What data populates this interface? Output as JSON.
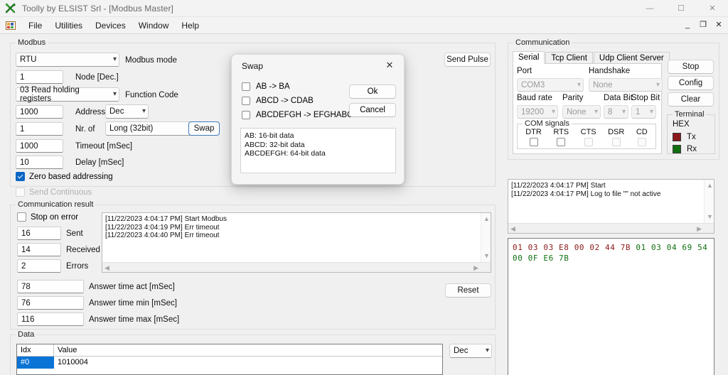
{
  "window": {
    "title": "Toolly by ELSIST Srl - [Modbus Master]",
    "app_icon": "tools-cross-icon",
    "minimize": "—",
    "maximize": "☐",
    "close": "✕"
  },
  "menubar": {
    "icon": "mdi-window-icon",
    "items": [
      "File",
      "Utilities",
      "Devices",
      "Window",
      "Help"
    ],
    "mdi_restore_down": "_",
    "mdi_restore": "❐",
    "mdi_close": "✕"
  },
  "modbus": {
    "legend": "Modbus",
    "mode_value": "RTU",
    "mode_label": "Modbus mode",
    "node_value": "1",
    "node_label": "Node [Dec.]",
    "function_code_value": "03 Read holding registers",
    "function_code_label": "Function Code",
    "address_value": "1000",
    "address_label": "Address",
    "address_base_value": "Dec",
    "nr_of_value": "1",
    "nr_of_label": "Nr. of",
    "data_type_value": "Long (32bit)",
    "swap_button": "Swap",
    "timeout_value": "1000",
    "timeout_label": "Timeout [mSec]",
    "delay_value": "10",
    "delay_label": "Delay [mSec]",
    "zero_based_label": "Zero based addressing",
    "zero_based_checked": true,
    "send_continuous_label": "Send Continuous",
    "send_continuous_checked": false,
    "send_pulse_button": "Send Pulse"
  },
  "comm_result": {
    "legend": "Communication result",
    "stop_on_error_label": "Stop on error",
    "stop_on_error_checked": false,
    "sent_value": "16",
    "sent_label": "Sent",
    "received_value": "14",
    "received_label": "Received",
    "errors_value": "2",
    "errors_label": "Errors",
    "answer_act_value": "78",
    "answer_act_label": "Answer time act [mSec]",
    "answer_min_value": "76",
    "answer_min_label": "Answer time min [mSec]",
    "answer_max_value": "116",
    "answer_max_label": "Answer time max [mSec]",
    "reset_button": "Reset",
    "log_lines": [
      "[11/22/2023 4:04:17 PM] Start Modbus",
      "[11/22/2023 4:04:19 PM] Err timeout",
      "[11/22/2023 4:04:40 PM] Err timeout"
    ]
  },
  "data_panel": {
    "legend": "Data",
    "col_idx": "Idx",
    "col_value": "Value",
    "format_value": "Dec",
    "rows": [
      {
        "idx": "#0",
        "value": "1010004"
      }
    ]
  },
  "communication": {
    "legend": "Communication",
    "tabs": [
      {
        "label": "Serial",
        "active": true
      },
      {
        "label": "Tcp Client",
        "active": false
      },
      {
        "label": "Udp Client Server",
        "active": false
      }
    ],
    "port_label": "Port",
    "port_value": "COM3",
    "handshake_label": "Handshake",
    "handshake_value": "None",
    "baud_label": "Baud rate",
    "baud_value": "19200",
    "parity_label": "Parity",
    "parity_value": "None",
    "data_bit_label": "Data Bit",
    "data_bit_value": "8",
    "stop_bit_label": "Stop Bit",
    "stop_bit_value": "1",
    "com_signals_legend": "COM signals",
    "com_signals": [
      {
        "label": "DTR",
        "enabled": true
      },
      {
        "label": "RTS",
        "enabled": true
      },
      {
        "label": "CTS",
        "enabled": false
      },
      {
        "label": "DSR",
        "enabled": false
      },
      {
        "label": "CD",
        "enabled": false
      }
    ],
    "stop_button": "Stop",
    "config_button": "Config",
    "clear_button": "Clear",
    "terminal_legend": "Terminal",
    "terminal_mode": "HEX",
    "tx_label": "Tx",
    "rx_label": "Rx",
    "tx_color": "#8b1a1a",
    "rx_color": "#107010",
    "log_lines": [
      "[11/22/2023 4:04:17 PM] Start",
      "[11/22/2023 4:04:17 PM] Log to file \"\" not active"
    ],
    "hex_lines": [
      [
        {
          "t": "01",
          "c": "tx"
        },
        {
          "t": "03",
          "c": "tx"
        },
        {
          "t": "03",
          "c": "tx"
        },
        {
          "t": "E8",
          "c": "tx"
        },
        {
          "t": "00",
          "c": "tx"
        },
        {
          "t": "02",
          "c": "tx"
        },
        {
          "t": "44",
          "c": "tx"
        },
        {
          "t": "7B",
          "c": "tx"
        },
        {
          "t": "01",
          "c": "rx"
        },
        {
          "t": "03",
          "c": "rx"
        },
        {
          "t": "04",
          "c": "rx"
        },
        {
          "t": "69",
          "c": "rx"
        },
        {
          "t": "54",
          "c": "rx"
        }
      ],
      [
        {
          "t": "00",
          "c": "rx"
        },
        {
          "t": "0F",
          "c": "rx"
        },
        {
          "t": "E6",
          "c": "rx"
        },
        {
          "t": "7B",
          "c": "rx"
        }
      ]
    ]
  },
  "swap_dialog": {
    "title": "Swap",
    "close_icon": "✕",
    "options": [
      {
        "label": "AB -> BA",
        "checked": false
      },
      {
        "label": "ABCD -> CDAB",
        "checked": false
      },
      {
        "label": "ABCDEFGH -> EFGHABCD",
        "checked": false
      }
    ],
    "ok_button": "Ok",
    "cancel_button": "Cancel",
    "info_lines": [
      "AB: 16-bit data",
      "ABCD: 32-bit data",
      "ABCDEFGH: 64-bit data"
    ]
  }
}
